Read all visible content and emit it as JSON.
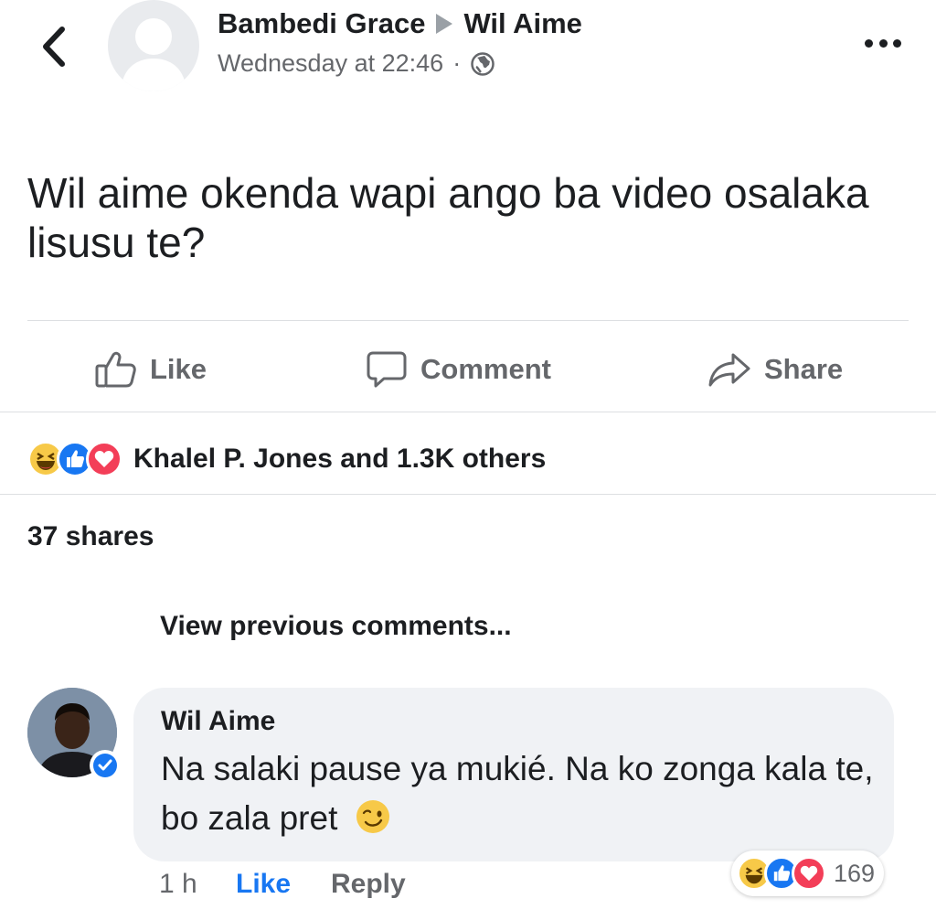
{
  "post": {
    "author": "Bambedi Grace",
    "target": "Wil Aime",
    "timestamp": "Wednesday at 22:46",
    "separator": "·",
    "privacy_icon": "globe-icon",
    "text": "Wil aime okenda wapi ango ba video osalaka lisusu te?"
  },
  "actions": {
    "like_label": "Like",
    "comment_label": "Comment",
    "share_label": "Share"
  },
  "reactions": {
    "icons": [
      "haha-icon",
      "like-icon",
      "love-icon"
    ],
    "summary": "Khalel P. Jones and 1.3K others"
  },
  "shares": "37 shares",
  "view_previous": "View previous comments...",
  "comment": {
    "author": "Wil Aime",
    "text": "Na salaki pause ya mukié. Na ko zonga kala te, bo zala pret",
    "emoji": "wink-emoji",
    "time": "1 h",
    "like_label": "Like",
    "reply_label": "Reply",
    "reaction_count": "169"
  },
  "colors": {
    "brand_blue": "#1877f2",
    "love_red": "#f33e58",
    "haha_yellow": "#f7c948",
    "secondary_text": "#65676b"
  }
}
